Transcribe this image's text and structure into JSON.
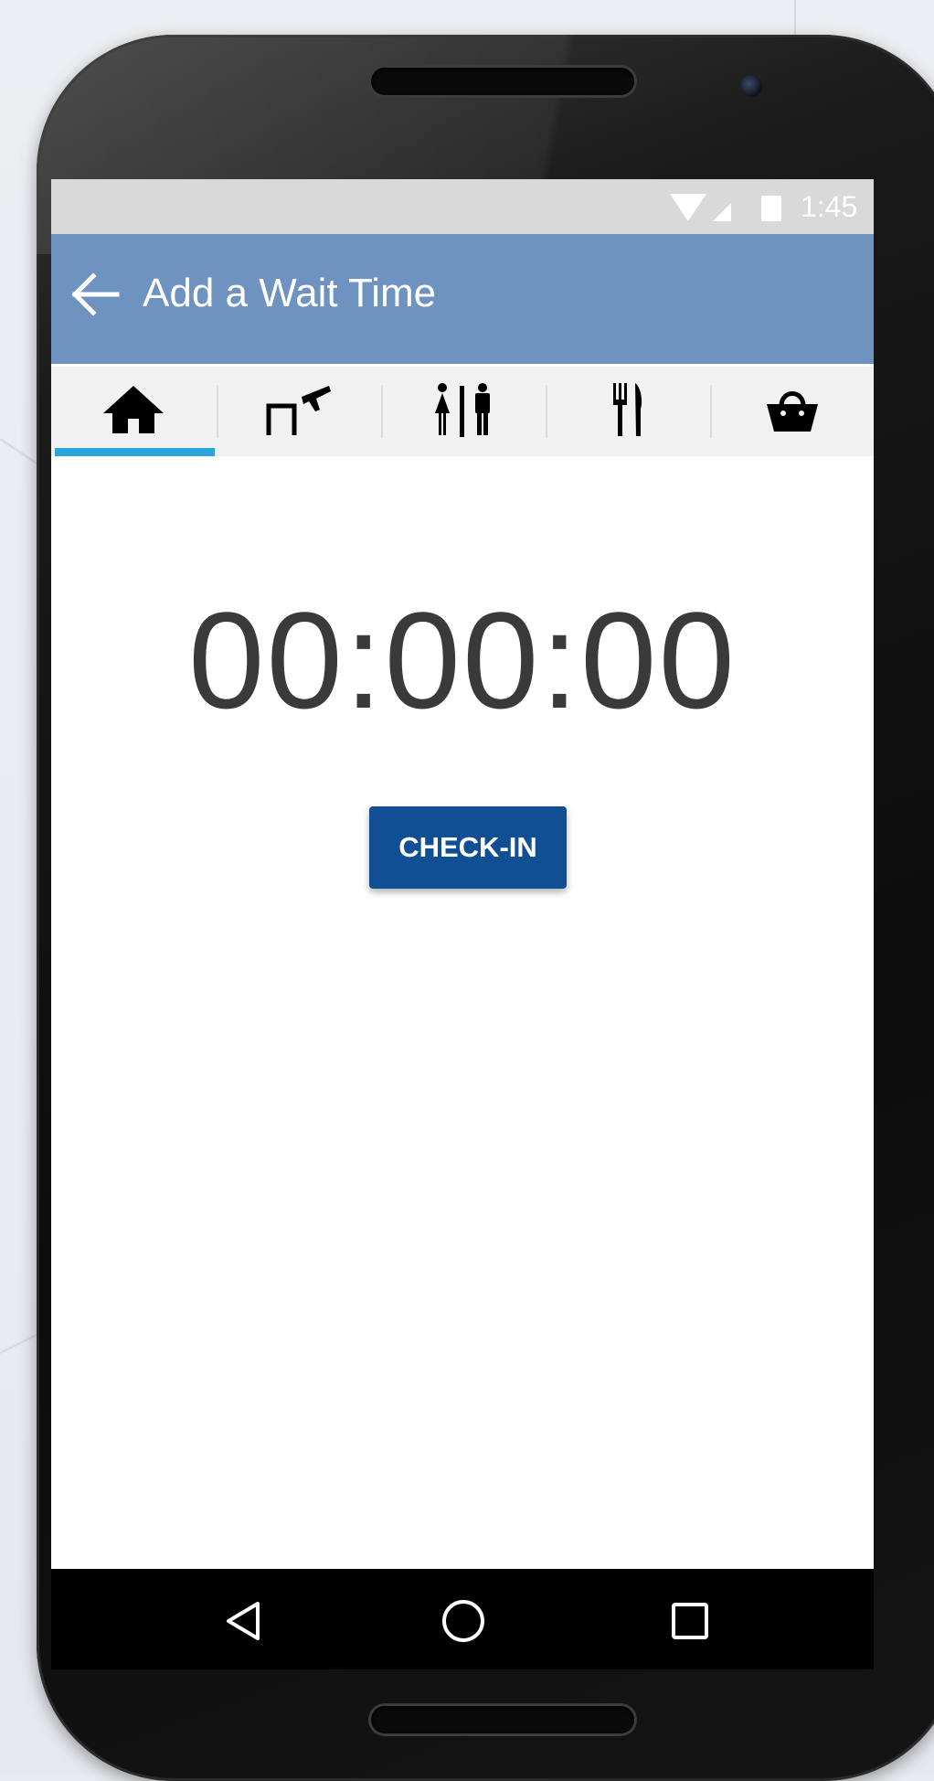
{
  "status_bar": {
    "time": "1:45",
    "icons": [
      "wifi-icon",
      "cell-signal-icon",
      "battery-icon"
    ]
  },
  "app_bar": {
    "back_icon": "arrow-left-icon",
    "title": "Add a Wait Time"
  },
  "tabs": [
    {
      "icon": "home-icon",
      "selected": true
    },
    {
      "icon": "gate-departure-icon",
      "selected": false
    },
    {
      "icon": "restroom-icon",
      "selected": false
    },
    {
      "icon": "restaurant-icon",
      "selected": false
    },
    {
      "icon": "shopping-basket-icon",
      "selected": false
    }
  ],
  "timer": {
    "value": "00:00:00"
  },
  "check_in": {
    "label": "CHECK-IN"
  },
  "nav": {
    "icons": [
      "back-triangle-icon",
      "home-circle-icon",
      "recents-square-icon"
    ]
  },
  "colors": {
    "app_bar": "#6f93c0",
    "tab_indicator": "#2aa5dc",
    "button": "#114f95",
    "status_bar": "#d9d9d9"
  }
}
